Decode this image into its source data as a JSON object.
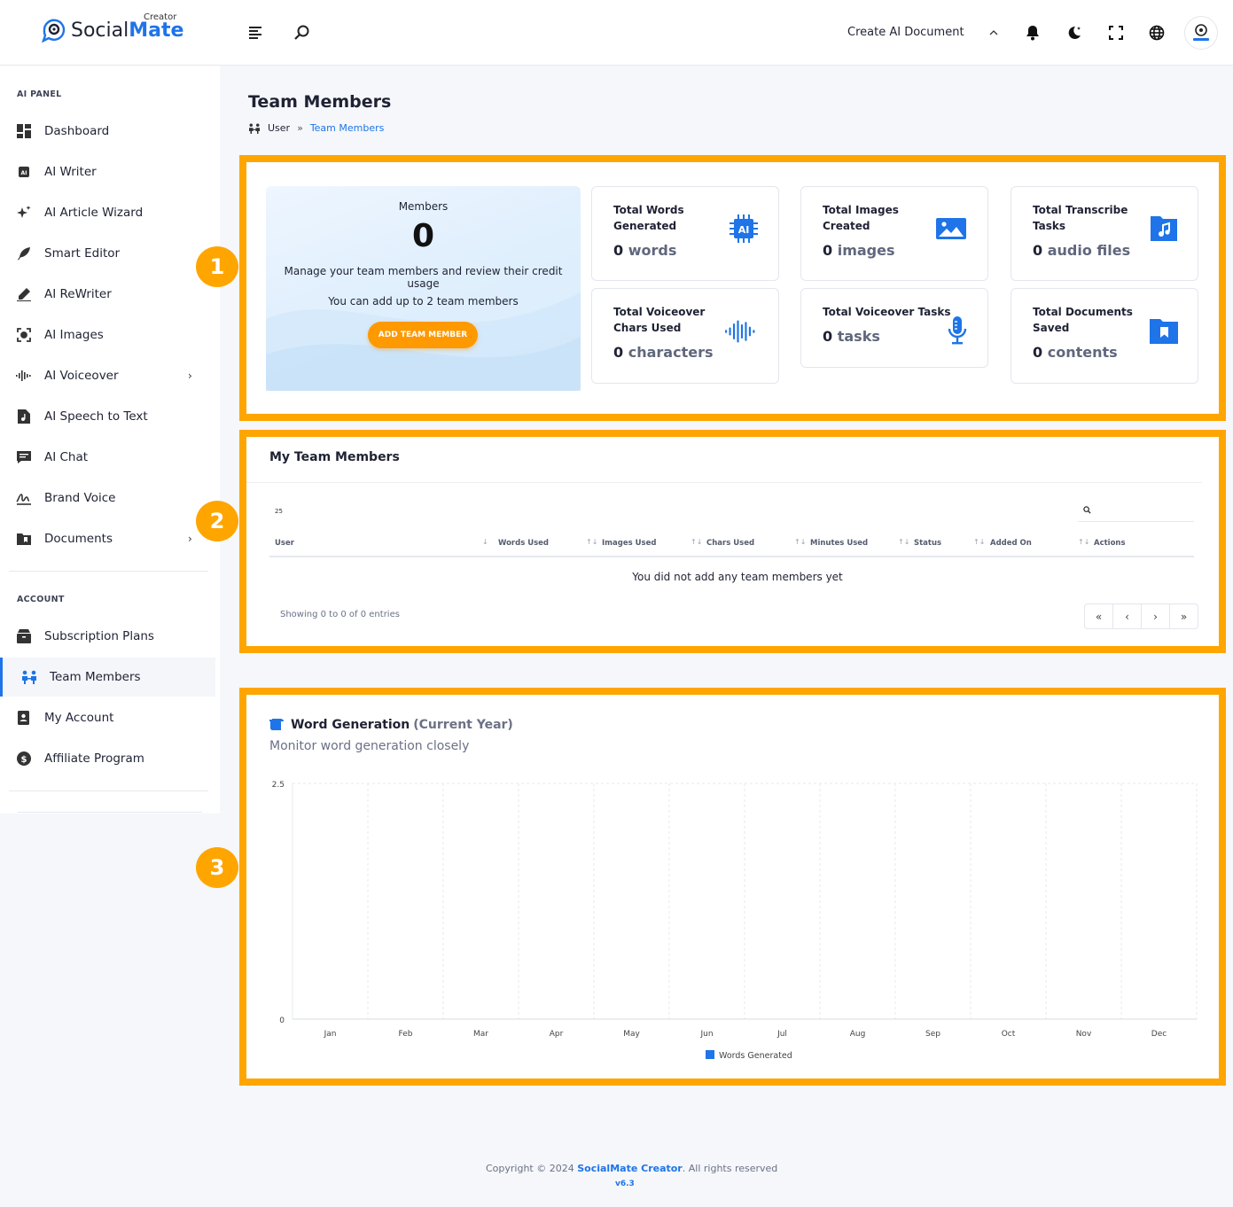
{
  "brand": {
    "name_plain": "Social",
    "name_bold": "Mate",
    "sup": "Creator",
    "accent": "#1e74e8"
  },
  "topbar": {
    "create_doc": "Create AI Document"
  },
  "sidebar": {
    "section_ai": "AI PANEL",
    "items": [
      {
        "label": "Dashboard"
      },
      {
        "label": "AI Writer"
      },
      {
        "label": "AI Article Wizard"
      },
      {
        "label": "Smart Editor"
      },
      {
        "label": "AI ReWriter"
      },
      {
        "label": "AI Images"
      },
      {
        "label": "AI Voiceover"
      },
      {
        "label": "AI Speech to Text"
      },
      {
        "label": "AI Chat"
      },
      {
        "label": "Brand Voice"
      },
      {
        "label": "Documents"
      }
    ],
    "section_account": "ACCOUNT",
    "account_items": [
      {
        "label": "Subscription Plans"
      },
      {
        "label": "Team Members"
      },
      {
        "label": "My Account"
      },
      {
        "label": "Affiliate Program"
      }
    ]
  },
  "page": {
    "title": "Team Members",
    "breadcrumb": [
      "User",
      "»",
      "Team Members"
    ]
  },
  "markers": [
    "1",
    "2",
    "3"
  ],
  "highlight_color": "#ffa500",
  "members_card": {
    "label": "Members",
    "count": "0",
    "desc": "Manage your team members and review their credit usage",
    "limit": "You can add up to 2 team members",
    "button": "ADD TEAM MEMBER"
  },
  "stats": [
    {
      "title": "Total Words Generated",
      "value": "0",
      "unit": "words",
      "icon": "ai-chip-icon"
    },
    {
      "title": "Total Images Created",
      "value": "0",
      "unit": "images",
      "icon": "image-icon"
    },
    {
      "title": "Total Transcribe Tasks",
      "value": "0",
      "unit": "audio files",
      "icon": "audio-file-icon"
    },
    {
      "title": "Total Voiceover Chars Used",
      "value": "0",
      "unit": "characters",
      "icon": "soundwave-icon"
    },
    {
      "title": "Total Voiceover Tasks",
      "value": "0",
      "unit": "tasks",
      "icon": "microphone-icon"
    },
    {
      "title": "Total Documents Saved",
      "value": "0",
      "unit": "contents",
      "icon": "bookmark-folder-icon"
    }
  ],
  "team_table": {
    "title": "My Team Members",
    "page_length": "25",
    "columns": [
      "User",
      "Words Used",
      "Images Used",
      "Chars Used",
      "Minutes Used",
      "Status",
      "Added On",
      "Actions"
    ],
    "empty": "You did not add any team members yet",
    "showing": "Showing 0 to 0 of 0 entries",
    "pager": [
      "«",
      "‹",
      "›",
      "»"
    ]
  },
  "chart_section": {
    "title": "Word Generation",
    "title_muted": "(Current Year)",
    "subtitle": "Monitor word generation closely"
  },
  "chart_data": {
    "type": "bar",
    "categories": [
      "Jan",
      "Feb",
      "Mar",
      "Apr",
      "May",
      "Jun",
      "Jul",
      "Aug",
      "Sep",
      "Oct",
      "Nov",
      "Dec"
    ],
    "series": [
      {
        "name": "Words Generated",
        "values": [
          0,
          0,
          0,
          0,
          0,
          0,
          0,
          0,
          0,
          0,
          0,
          0
        ],
        "color": "#1e74e8"
      }
    ],
    "ylim": [
      0,
      2.5
    ],
    "yticks": [
      "2.5",
      "0"
    ],
    "grid": true,
    "legend": "bottom"
  },
  "footer": {
    "copyright_pre": "Copyright © 2024 ",
    "brand": "SocialMate Creator",
    "copyright_post": ". All rights reserved",
    "version": "v6.3"
  }
}
